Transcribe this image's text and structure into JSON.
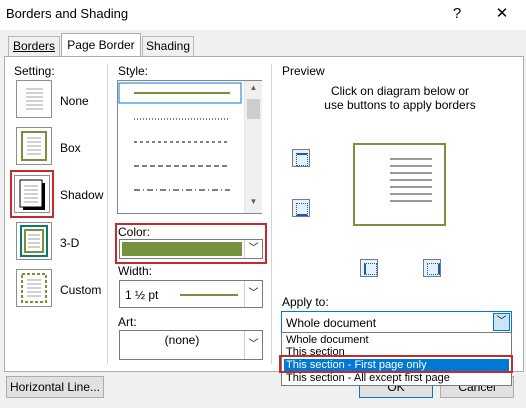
{
  "dialog": {
    "title": "Borders and Shading",
    "help_label": "?",
    "close_label": "✕"
  },
  "tabs": [
    {
      "label": "Borders",
      "active": false
    },
    {
      "label": "Page Border",
      "active": true
    },
    {
      "label": "Shading",
      "active": false
    }
  ],
  "setting": {
    "label": "Setting:",
    "items": [
      {
        "label": "None",
        "selected": false
      },
      {
        "label": "Box",
        "selected": false
      },
      {
        "label": "Shadow",
        "selected": true
      },
      {
        "label": "3-D",
        "selected": false
      },
      {
        "label": "Custom",
        "selected": false
      }
    ]
  },
  "style": {
    "label": "Style:"
  },
  "color": {
    "label": "Color:",
    "value": "#76923c"
  },
  "width": {
    "label": "Width:",
    "value": "1 ½ pt"
  },
  "art": {
    "label": "Art:",
    "value": "(none)"
  },
  "preview": {
    "label": "Preview",
    "instructions": "Click on diagram below or use buttons to apply borders"
  },
  "apply_to": {
    "label": "Apply to:",
    "value": "Whole document",
    "options": [
      {
        "label": "Whole document",
        "selected": false
      },
      {
        "label": "This section",
        "selected": false
      },
      {
        "label": "This section - First page only",
        "selected": true
      },
      {
        "label": "This section - All except first page",
        "selected": false
      }
    ]
  },
  "buttons": {
    "horizontal_line": "Horizontal Line...",
    "ok": "OK",
    "cancel": "Cancel"
  },
  "colors": {
    "accent": "#76923c",
    "highlight": "#c42b2b",
    "selection": "#0078d7"
  }
}
